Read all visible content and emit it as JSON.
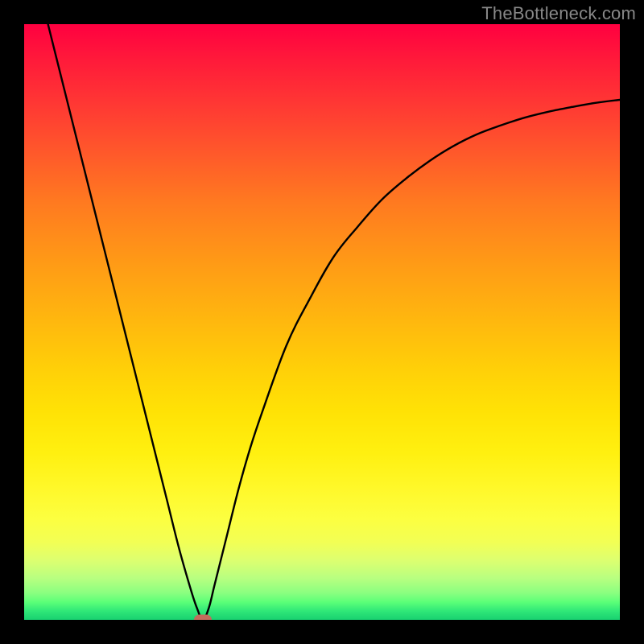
{
  "watermark": "TheBottleneck.com",
  "chart_data": {
    "type": "line",
    "title": "",
    "xlabel": "",
    "ylabel": "",
    "xlim": [
      0,
      100
    ],
    "ylim": [
      0,
      100
    ],
    "grid": false,
    "legend": false,
    "series": [
      {
        "name": "curve",
        "x": [
          4,
          6,
          8,
          10,
          12,
          14,
          16,
          18,
          20,
          22,
          24,
          26,
          28,
          29,
          30,
          31,
          32,
          34,
          36,
          38,
          40,
          44,
          48,
          52,
          56,
          60,
          64,
          68,
          72,
          76,
          80,
          84,
          88,
          92,
          96,
          100
        ],
        "values": [
          100,
          92,
          84,
          76,
          68,
          60,
          52,
          44,
          36,
          28,
          20,
          12,
          5,
          2,
          0,
          2,
          6,
          14,
          22,
          29,
          35,
          46,
          54,
          61,
          66,
          70.5,
          74,
          77,
          79.5,
          81.5,
          83,
          84.3,
          85.3,
          86.1,
          86.8,
          87.3
        ]
      }
    ],
    "marker": {
      "x": 30,
      "y": 0,
      "shape": "rounded-rect",
      "color": "#c36b5c"
    },
    "background_gradient": {
      "direction": "vertical",
      "stops": [
        {
          "pos": 0,
          "color": "#ff0040"
        },
        {
          "pos": 50,
          "color": "#ffb80e"
        },
        {
          "pos": 78,
          "color": "#fff82a"
        },
        {
          "pos": 100,
          "color": "#18d070"
        }
      ]
    }
  },
  "colors": {
    "frame": "#000000",
    "curve": "#000000",
    "watermark": "#888888",
    "marker": "#c36b5c"
  }
}
